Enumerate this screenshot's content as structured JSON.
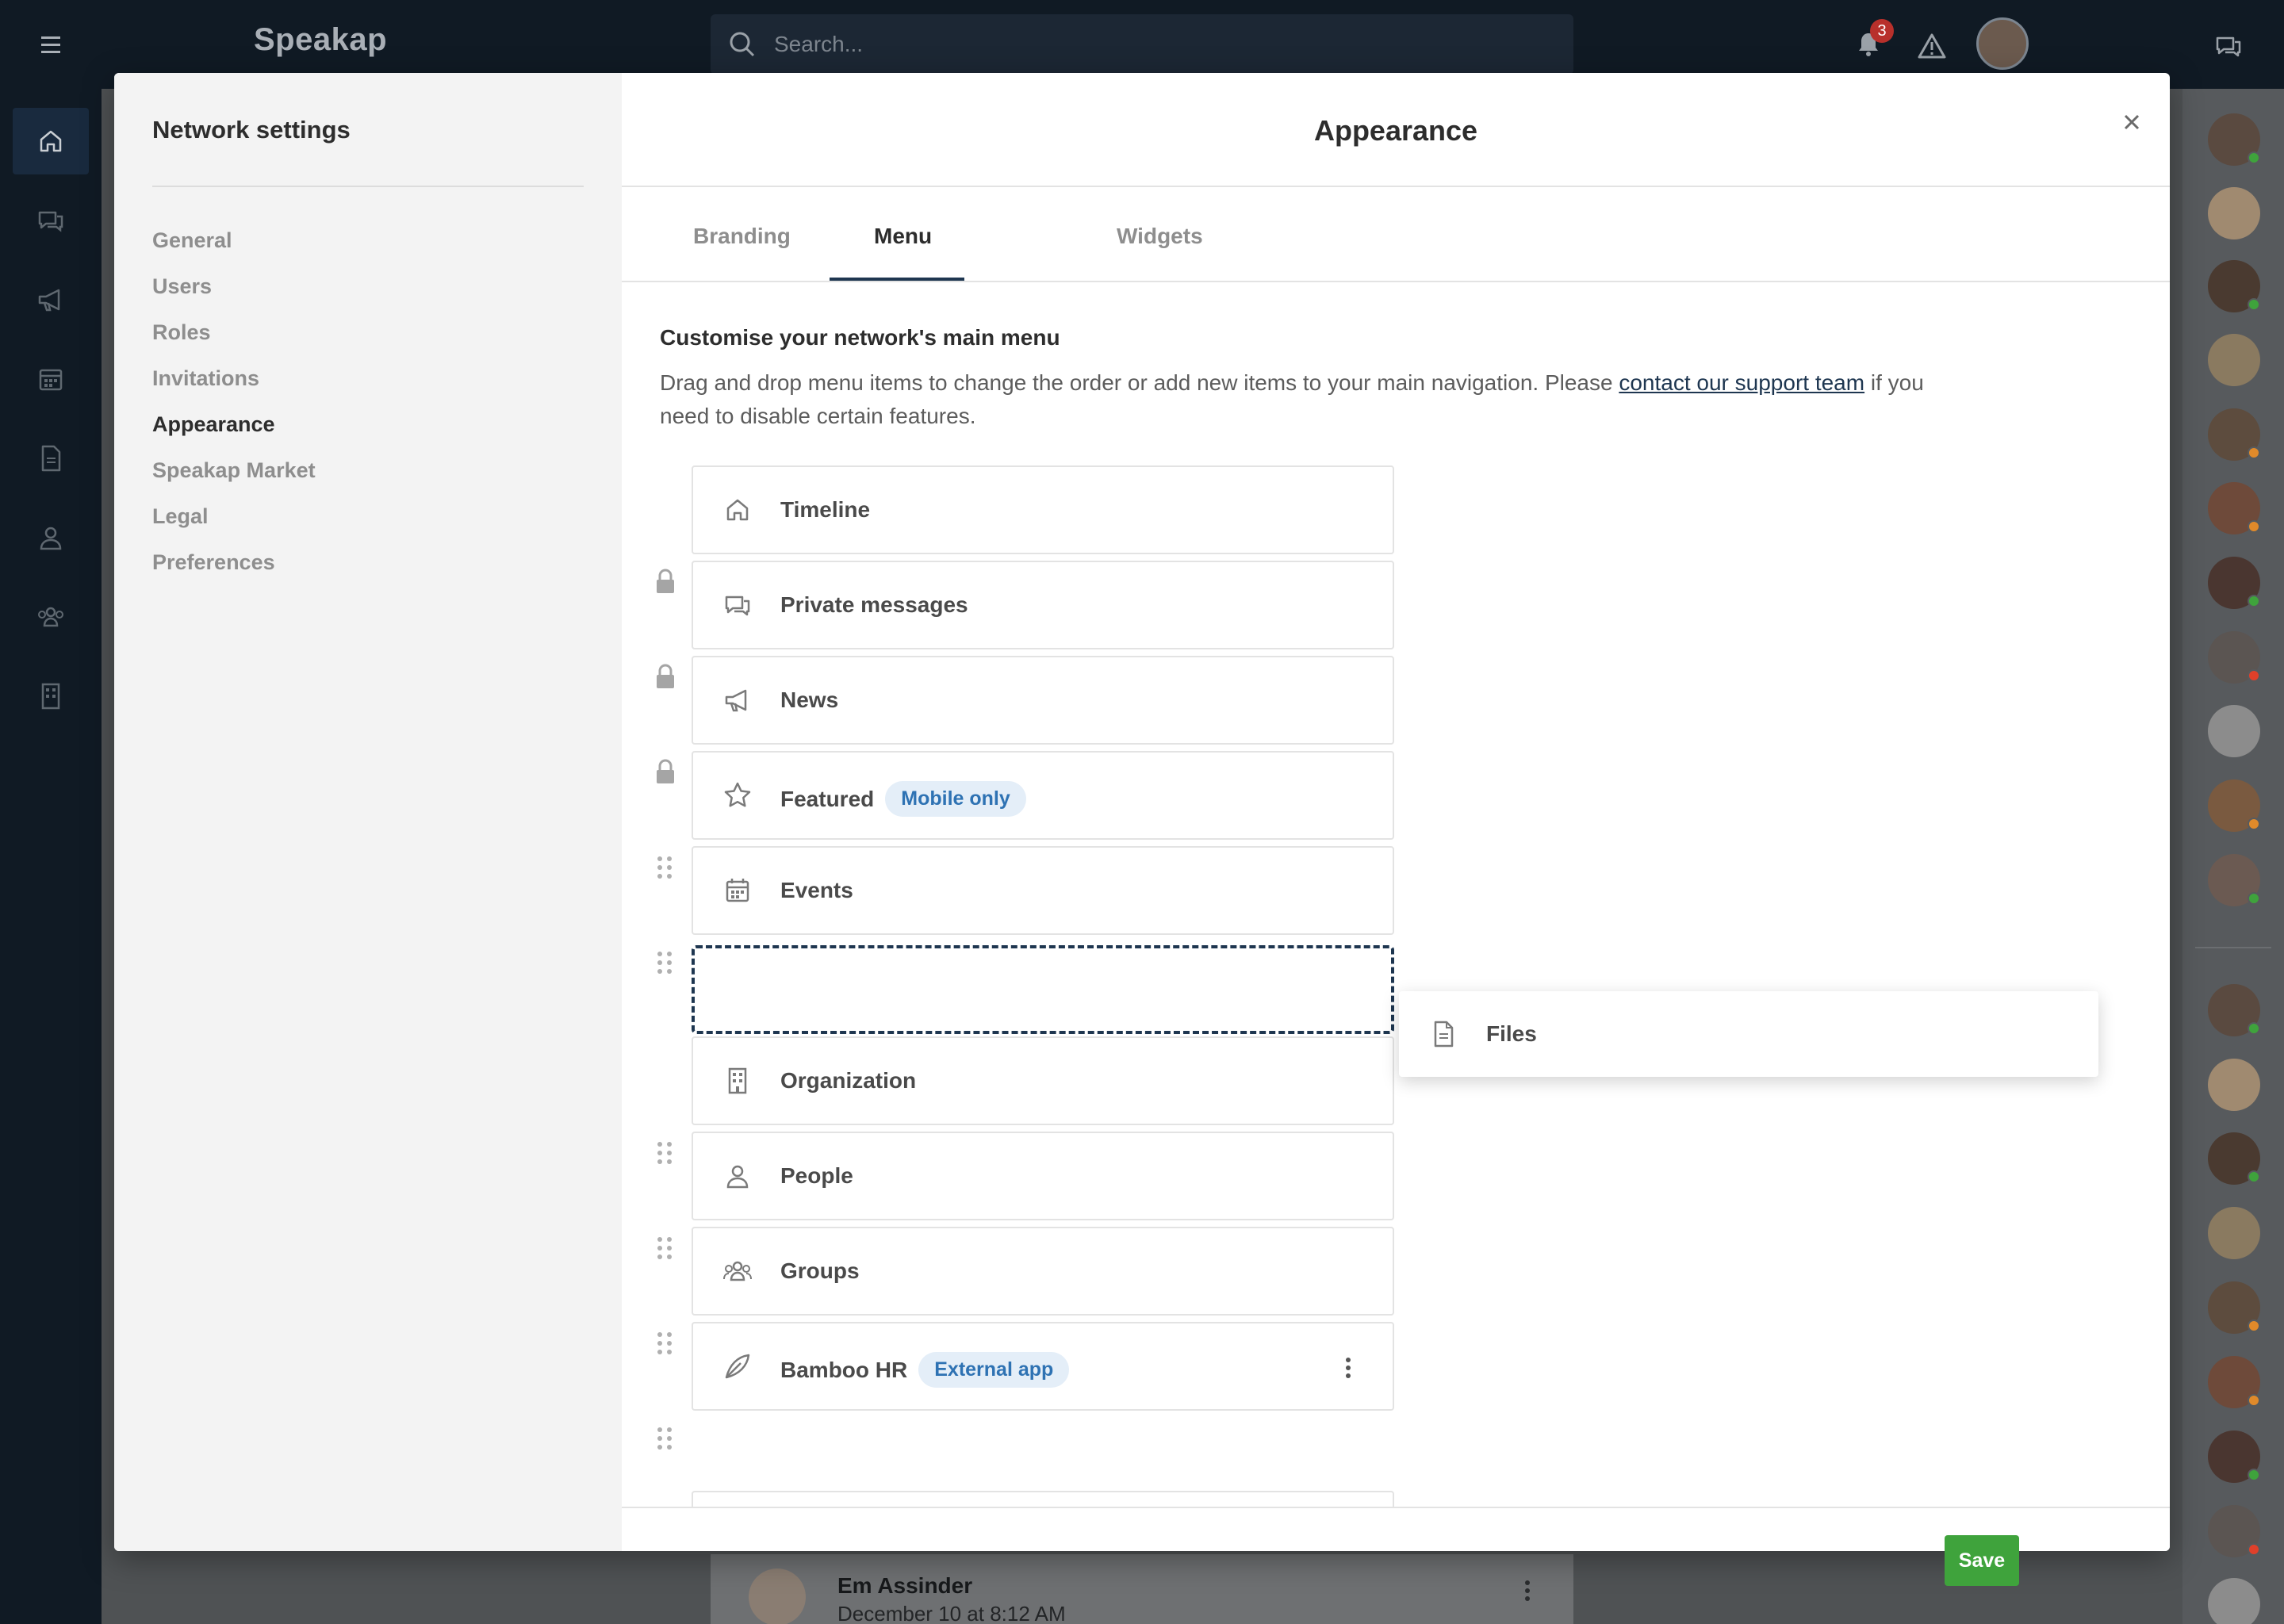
{
  "app": {
    "brand": "Speakap",
    "search_placeholder": "Search...",
    "notification_count": "3"
  },
  "background_post": {
    "author": "Em Assinder",
    "date": "December 10 at 8:12 AM"
  },
  "modal": {
    "sidebar_title": "Network settings",
    "nav": [
      {
        "label": "General",
        "active": false
      },
      {
        "label": "Users",
        "active": false
      },
      {
        "label": "Roles",
        "active": false
      },
      {
        "label": "Invitations",
        "active": false
      },
      {
        "label": "Appearance",
        "active": true
      },
      {
        "label": "Speakap Market",
        "active": false
      },
      {
        "label": "Legal",
        "active": false
      },
      {
        "label": "Preferences",
        "active": false
      }
    ],
    "title": "Appearance",
    "tabs": [
      {
        "label": "Branding",
        "active": false
      },
      {
        "label": "Menu",
        "active": true
      },
      {
        "label": "Widgets",
        "active": false
      }
    ],
    "section_heading": "Customise your network's main menu",
    "description_before": "Drag and drop menu items to change the order or add new items to your main navigation. Please ",
    "description_link": "contact our support team",
    "description_after": " if you need to disable certain features.",
    "menu_items": [
      {
        "label": "Timeline",
        "icon": "home-icon",
        "locked": true
      },
      {
        "label": "Private messages",
        "icon": "chat-icon",
        "locked": true
      },
      {
        "label": "News",
        "icon": "megaphone-icon",
        "locked": true
      },
      {
        "label": "Featured",
        "icon": "star-icon",
        "locked": false,
        "badge": "Mobile only"
      },
      {
        "label": "Events",
        "icon": "calendar-icon",
        "locked": false
      },
      {
        "label": "Organization",
        "icon": "building-icon",
        "locked": false
      },
      {
        "label": "People",
        "icon": "person-icon",
        "locked": false
      },
      {
        "label": "Groups",
        "icon": "group-icon",
        "locked": false
      },
      {
        "label": "Bamboo HR",
        "icon": "leaf-icon",
        "locked": false,
        "badge": "External app"
      }
    ],
    "dragging_item": {
      "label": "Files",
      "icon": "file-icon"
    },
    "save_label": "Save"
  },
  "colors": {
    "accent": "#1e3650",
    "save": "#3fa33c",
    "badge_bg": "#e4eef8",
    "badge_text": "#2e72b3"
  }
}
